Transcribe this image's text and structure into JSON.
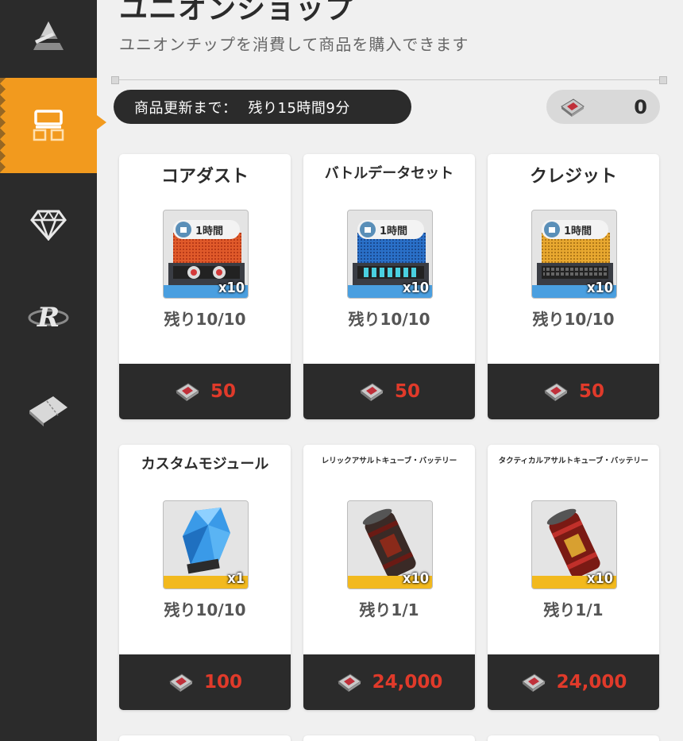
{
  "header": {
    "title": "ユニオンショップ",
    "subtitle": "ユニオンチップを消費して商品を購入できます"
  },
  "refresh": {
    "label": "商品更新まで：",
    "value": "残り15時間9分"
  },
  "currency": {
    "icon": "union-chip-icon",
    "amount": "0"
  },
  "sidebar": {
    "items": [
      {
        "icon": "arena-icon",
        "active": false
      },
      {
        "icon": "union-shop-icon",
        "active": true
      },
      {
        "icon": "gem-icon",
        "active": false
      },
      {
        "icon": "recycle-r-icon",
        "active": false
      },
      {
        "icon": "ticket-icon",
        "active": false
      }
    ]
  },
  "colors": {
    "accent": "#f29a1e",
    "dark": "#2b2b2b",
    "price": "#e03a2a"
  },
  "cards": [
    {
      "name": "コアダスト",
      "timer": "1時間",
      "qty": "x10",
      "stock": "残り10/10",
      "price": "50"
    },
    {
      "name": "バトルデータセット",
      "timer": "1時間",
      "qty": "x10",
      "stock": "残り10/10",
      "price": "50"
    },
    {
      "name": "クレジット",
      "timer": "1時間",
      "qty": "x10",
      "stock": "残り10/10",
      "price": "50"
    },
    {
      "name": "カスタムモジュール",
      "timer": "",
      "qty": "x1",
      "stock": "残り10/10",
      "price": "100"
    },
    {
      "name": "レリックアサルトキューブ・バッテリー",
      "timer": "",
      "qty": "x10",
      "stock": "残り1/1",
      "price": "24,000"
    },
    {
      "name": "タクティカルアサルトキューブ・バッテリー",
      "timer": "",
      "qty": "x10",
      "stock": "残り1/1",
      "price": "24,000"
    }
  ]
}
